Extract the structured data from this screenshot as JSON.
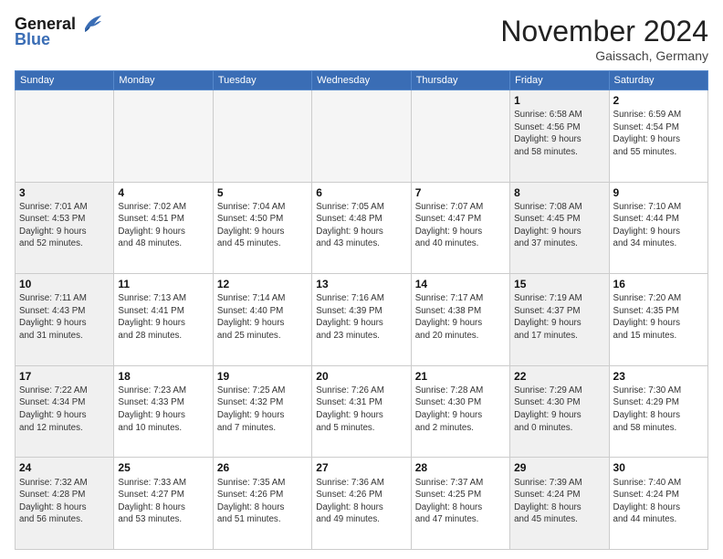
{
  "logo": {
    "line1": "General",
    "line2": "Blue"
  },
  "title": "November 2024",
  "location": "Gaissach, Germany",
  "days_header": [
    "Sunday",
    "Monday",
    "Tuesday",
    "Wednesday",
    "Thursday",
    "Friday",
    "Saturday"
  ],
  "weeks": [
    [
      {
        "num": "",
        "info": "",
        "empty": true
      },
      {
        "num": "",
        "info": "",
        "empty": true
      },
      {
        "num": "",
        "info": "",
        "empty": true
      },
      {
        "num": "",
        "info": "",
        "empty": true
      },
      {
        "num": "",
        "info": "",
        "empty": true
      },
      {
        "num": "1",
        "info": "Sunrise: 6:58 AM\nSunset: 4:56 PM\nDaylight: 9 hours\nand 58 minutes.",
        "shaded": true
      },
      {
        "num": "2",
        "info": "Sunrise: 6:59 AM\nSunset: 4:54 PM\nDaylight: 9 hours\nand 55 minutes."
      }
    ],
    [
      {
        "num": "3",
        "info": "Sunrise: 7:01 AM\nSunset: 4:53 PM\nDaylight: 9 hours\nand 52 minutes.",
        "shaded": true
      },
      {
        "num": "4",
        "info": "Sunrise: 7:02 AM\nSunset: 4:51 PM\nDaylight: 9 hours\nand 48 minutes."
      },
      {
        "num": "5",
        "info": "Sunrise: 7:04 AM\nSunset: 4:50 PM\nDaylight: 9 hours\nand 45 minutes."
      },
      {
        "num": "6",
        "info": "Sunrise: 7:05 AM\nSunset: 4:48 PM\nDaylight: 9 hours\nand 43 minutes."
      },
      {
        "num": "7",
        "info": "Sunrise: 7:07 AM\nSunset: 4:47 PM\nDaylight: 9 hours\nand 40 minutes."
      },
      {
        "num": "8",
        "info": "Sunrise: 7:08 AM\nSunset: 4:45 PM\nDaylight: 9 hours\nand 37 minutes.",
        "shaded": true
      },
      {
        "num": "9",
        "info": "Sunrise: 7:10 AM\nSunset: 4:44 PM\nDaylight: 9 hours\nand 34 minutes."
      }
    ],
    [
      {
        "num": "10",
        "info": "Sunrise: 7:11 AM\nSunset: 4:43 PM\nDaylight: 9 hours\nand 31 minutes.",
        "shaded": true
      },
      {
        "num": "11",
        "info": "Sunrise: 7:13 AM\nSunset: 4:41 PM\nDaylight: 9 hours\nand 28 minutes."
      },
      {
        "num": "12",
        "info": "Sunrise: 7:14 AM\nSunset: 4:40 PM\nDaylight: 9 hours\nand 25 minutes."
      },
      {
        "num": "13",
        "info": "Sunrise: 7:16 AM\nSunset: 4:39 PM\nDaylight: 9 hours\nand 23 minutes."
      },
      {
        "num": "14",
        "info": "Sunrise: 7:17 AM\nSunset: 4:38 PM\nDaylight: 9 hours\nand 20 minutes."
      },
      {
        "num": "15",
        "info": "Sunrise: 7:19 AM\nSunset: 4:37 PM\nDaylight: 9 hours\nand 17 minutes.",
        "shaded": true
      },
      {
        "num": "16",
        "info": "Sunrise: 7:20 AM\nSunset: 4:35 PM\nDaylight: 9 hours\nand 15 minutes."
      }
    ],
    [
      {
        "num": "17",
        "info": "Sunrise: 7:22 AM\nSunset: 4:34 PM\nDaylight: 9 hours\nand 12 minutes.",
        "shaded": true
      },
      {
        "num": "18",
        "info": "Sunrise: 7:23 AM\nSunset: 4:33 PM\nDaylight: 9 hours\nand 10 minutes."
      },
      {
        "num": "19",
        "info": "Sunrise: 7:25 AM\nSunset: 4:32 PM\nDaylight: 9 hours\nand 7 minutes."
      },
      {
        "num": "20",
        "info": "Sunrise: 7:26 AM\nSunset: 4:31 PM\nDaylight: 9 hours\nand 5 minutes."
      },
      {
        "num": "21",
        "info": "Sunrise: 7:28 AM\nSunset: 4:30 PM\nDaylight: 9 hours\nand 2 minutes."
      },
      {
        "num": "22",
        "info": "Sunrise: 7:29 AM\nSunset: 4:30 PM\nDaylight: 9 hours\nand 0 minutes.",
        "shaded": true
      },
      {
        "num": "23",
        "info": "Sunrise: 7:30 AM\nSunset: 4:29 PM\nDaylight: 8 hours\nand 58 minutes."
      }
    ],
    [
      {
        "num": "24",
        "info": "Sunrise: 7:32 AM\nSunset: 4:28 PM\nDaylight: 8 hours\nand 56 minutes.",
        "shaded": true
      },
      {
        "num": "25",
        "info": "Sunrise: 7:33 AM\nSunset: 4:27 PM\nDaylight: 8 hours\nand 53 minutes."
      },
      {
        "num": "26",
        "info": "Sunrise: 7:35 AM\nSunset: 4:26 PM\nDaylight: 8 hours\nand 51 minutes."
      },
      {
        "num": "27",
        "info": "Sunrise: 7:36 AM\nSunset: 4:26 PM\nDaylight: 8 hours\nand 49 minutes."
      },
      {
        "num": "28",
        "info": "Sunrise: 7:37 AM\nSunset: 4:25 PM\nDaylight: 8 hours\nand 47 minutes."
      },
      {
        "num": "29",
        "info": "Sunrise: 7:39 AM\nSunset: 4:24 PM\nDaylight: 8 hours\nand 45 minutes.",
        "shaded": true
      },
      {
        "num": "30",
        "info": "Sunrise: 7:40 AM\nSunset: 4:24 PM\nDaylight: 8 hours\nand 44 minutes."
      }
    ]
  ]
}
